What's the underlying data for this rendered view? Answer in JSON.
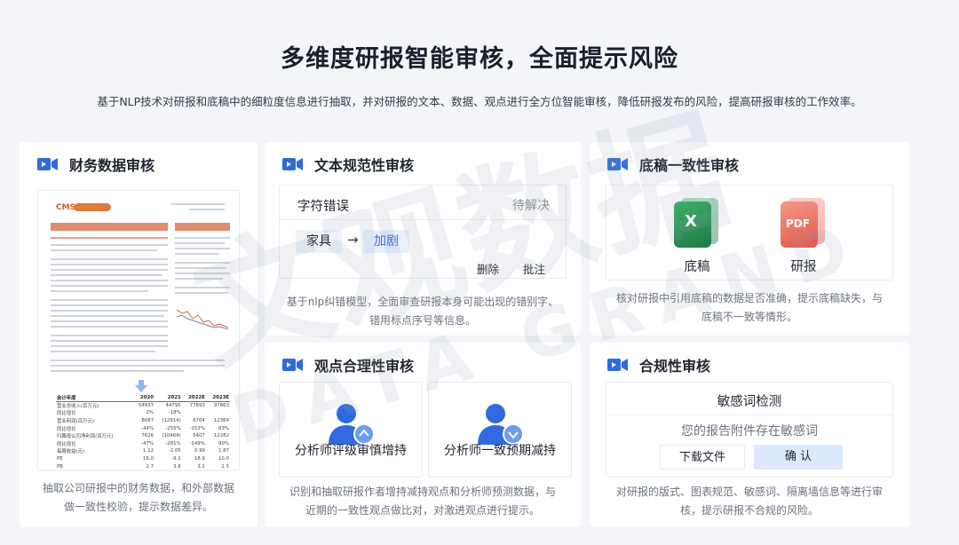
{
  "header": {
    "title": "多维度研报智能审核，全面提示风险",
    "subtitle": "基于NLP技术对研报和底稿中的细粒度信息进行抽取，并对研报的文本、数据、观点进行全方位智能审核，降低研报发布的风险，提高研报审核的工作效率。"
  },
  "colors": {
    "accent": "#2f6ae0",
    "icon_blue": "#2f6ae0",
    "excel_green": "#1d7a45",
    "pdf_red": "#e0574a"
  },
  "cards": {
    "financial": {
      "title": "财务数据审核",
      "icon": "video-icon",
      "desc": "抽取公司研报中的财务数据，和外部数据做一致性校验，提示数据差异。",
      "doc": {
        "logo": "CMS",
        "table": {
          "header": [
            "会计年度",
            "2020",
            "2021",
            "2022E",
            "2023E"
          ],
          "rows": [
            [
              "营业总收入(百万元)",
              "54937",
              "44795",
              "77893",
              "97863"
            ],
            [
              "同比增长",
              "2%",
              "-18%",
              "",
              ""
            ],
            [
              "营业利润(百万元)",
              "8087",
              "(12914)",
              "6764",
              "12364"
            ],
            [
              "同比增长",
              "-44%",
              "-255%",
              "-153%",
              "83%"
            ],
            [
              "归属母公司净利润(百万元)",
              "7626",
              "(10464)",
              "5407",
              "12282"
            ],
            [
              "同比增长",
              "-47%",
              "-281%",
              "-149%",
              "90%"
            ],
            [
              "每股收益(元)",
              "1.12",
              "-2.05",
              "0.99",
              "1.87"
            ],
            [
              "PE",
              "16.0",
              "-9.1",
              "18.9",
              "10.0"
            ],
            [
              "PB",
              "2.7",
              "3.8",
              "3.1",
              "2.5"
            ]
          ]
        }
      }
    },
    "text": {
      "title": "文本规范性审核",
      "icon": "video-icon",
      "label": "字符错误",
      "status": "待解决",
      "wrong": "家具",
      "correct": "加剧",
      "delete_label": "删除",
      "annotate_label": "批注",
      "desc_line1": "基于nlp纠错模型，全面审查研报本身可能出现的错别字、",
      "desc_line2": "错用标点序号等信息。"
    },
    "draft": {
      "title": "底稿一致性审核",
      "icon": "video-icon",
      "excel_label": "X",
      "pdf_label": "PDF",
      "excel_caption": "底稿",
      "pdf_caption": "研报",
      "desc_line1": "核对研报中引用底稿的数据是否准确，提示底稿缺失，与",
      "desc_line2": "底稿不一致等情形。"
    },
    "opinion": {
      "title": "观点合理性审核",
      "icon": "video-icon",
      "left_caption": "分析师评级审慎增持",
      "right_caption": "分析师一致预期减持",
      "desc_line1": "识别和抽取研报作者增持减持观点和分析师预测数据，与",
      "desc_line2": "近期的一致性观点做比对，对激进观点进行提示。"
    },
    "compliance": {
      "title": "合规性审核",
      "icon": "video-icon",
      "dialog_title": "敏感词检测",
      "dialog_msg": "您的报告附件存在敏感词",
      "download_label": "下载文件",
      "confirm_label": "确  认",
      "desc_line1": "对研报的版式、图表规范、敏感词、隔离墙信息等进行审",
      "desc_line2": "核，提示研报不合规的风险。"
    }
  },
  "watermark": {
    "cn": "文观数据",
    "en": "DATA GRAND"
  }
}
